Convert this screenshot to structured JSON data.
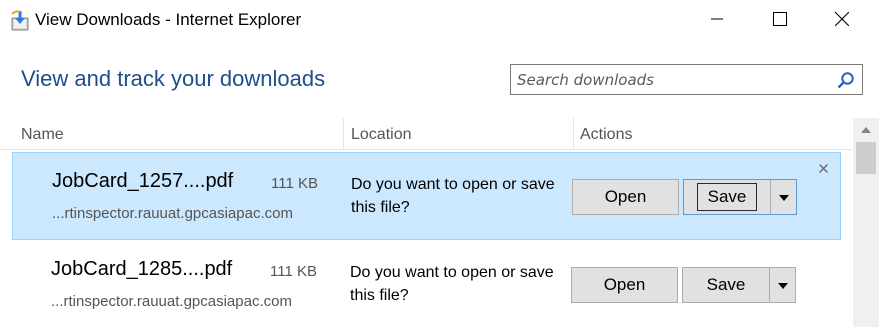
{
  "window": {
    "title": "View Downloads - Internet Explorer",
    "app_icon": "ie-downloads-icon",
    "controls": [
      "minimize-icon",
      "maximize-icon",
      "close-icon"
    ]
  },
  "header": {
    "heading": "View and track your downloads",
    "search": {
      "placeholder": "Search downloads",
      "value": ""
    }
  },
  "columns": {
    "name": "Name",
    "location": "Location",
    "actions": "Actions"
  },
  "downloads": [
    {
      "filename": "JobCard_1257....pdf",
      "size": "111 KB",
      "source": "...rtinspector.rauuat.gpcasiapac.com",
      "status": "Do you want to open or save this file?",
      "open_label": "Open",
      "save_label": "Save",
      "selected": true
    },
    {
      "filename": "JobCard_1285....pdf",
      "size": "111 KB",
      "source": "...rtinspector.rauuat.gpcasiapac.com",
      "status": "Do you want to open or save this file?",
      "open_label": "Open",
      "save_label": "Save",
      "selected": false
    }
  ],
  "colors": {
    "heading": "#1e4e8c",
    "selected_row_bg": "#cce8ff",
    "selected_row_border": "#99d1ff",
    "button_bg": "#e1e1e1"
  }
}
